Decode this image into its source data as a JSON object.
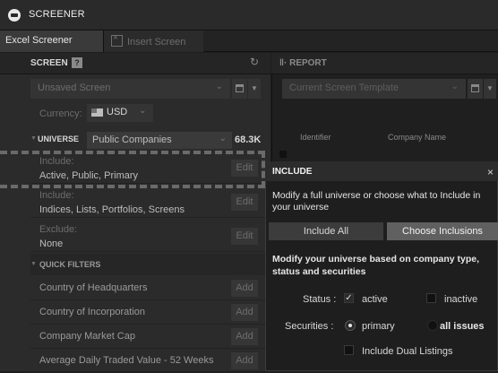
{
  "app": {
    "title": "SCREENER"
  },
  "tabs": [
    {
      "label": "Excel Screener",
      "active": true
    },
    {
      "label": "Insert Screen",
      "active": false
    }
  ],
  "screen_panel": {
    "title": "SCREEN",
    "help_glyph": "?",
    "refresh_glyph": "↻",
    "screen_select": "Unsaved Screen",
    "currency_label": "Currency:",
    "currency_value": "USD",
    "universe": {
      "label": "UNIVERSE",
      "value": "Public Companies",
      "count": "68.3K"
    },
    "criteria": [
      {
        "label": "Include:",
        "value": "Active, Public, Primary",
        "button": "Edit"
      },
      {
        "label": "Include:",
        "value": "Indices, Lists, Portfolios, Screens",
        "button": "Edit"
      },
      {
        "label": "Exclude:",
        "value": "None",
        "button": "Edit"
      }
    ],
    "quick_filters": {
      "label": "QUICK FILTERS",
      "items": [
        {
          "label": "Country of Headquarters",
          "button": "Add"
        },
        {
          "label": "Country of Incorporation",
          "button": "Add"
        },
        {
          "label": "Company Market Cap",
          "button": "Add"
        },
        {
          "label": "Average Daily Traded Value - 52 Weeks",
          "button": "Add"
        }
      ]
    }
  },
  "report_panel": {
    "title": "REPORT",
    "title_glyph": "‖·",
    "template_select": "Current Screen Template",
    "columns": [
      "Identifier",
      "Company Name"
    ]
  },
  "include_dialog": {
    "title": "INCLUDE",
    "close_glyph": "×",
    "description": "Modify a full universe or choose what to Include in your universe",
    "buttons": {
      "include_all": "Include All",
      "choose": "Choose Inclusions"
    },
    "modify_text": "Modify your universe based on company type, status and securities",
    "status": {
      "label": "Status :",
      "options": [
        {
          "label": "active",
          "checked": true
        },
        {
          "label": "inactive",
          "checked": false
        }
      ]
    },
    "securities": {
      "label": "Securities :",
      "options": [
        {
          "label": "primary",
          "selected": true
        },
        {
          "label": "all issues",
          "selected": false
        }
      ]
    },
    "dual_listings": {
      "label": "Include Dual Listings",
      "checked": false
    }
  },
  "glyphs": {
    "chevron": "⌄",
    "caret": "▼",
    "menu": "▼",
    "check": "✓"
  },
  "colors": {
    "background": "#1e1e1e",
    "panel": "#2b2b2b",
    "accent_button": "#606060"
  }
}
